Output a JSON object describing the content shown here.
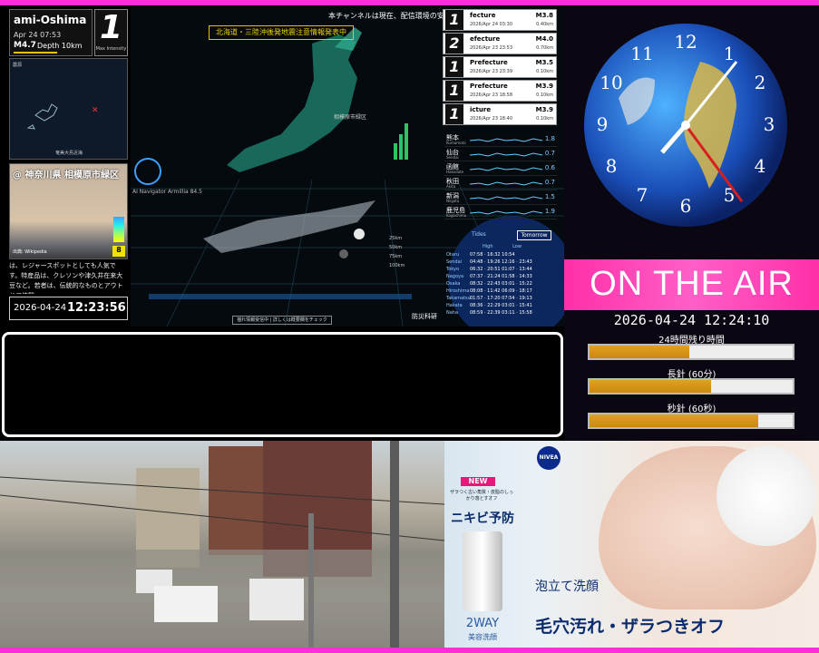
{
  "quake": {
    "location": "ami-Oshima",
    "time": "Apr 24 07:53",
    "magnitude": "M4.7",
    "depth": "Depth 10km",
    "max_intensity": "1",
    "max_intensity_label": "Max Intensity",
    "minimap_label": "震源",
    "minimap_caption": "奄美大島近海"
  },
  "photo": {
    "title": "@ 神奈川県 相模原市緑区",
    "credit": "出典: Wikipedia",
    "level": "8"
  },
  "description": "は、レジャースポットとしても人気です。特産品は、クレソンや津久井在来大豆など。若者は、伝統的なものとアウトドア体験…",
  "local_clock": {
    "date": "2026-04-24",
    "time": "12:23:56"
  },
  "map": {
    "ticker": "本チャンネルは現在、配信環境の安定",
    "alert": "北海道・三陸沖後発地震注意情報発表中",
    "radar_label": "AI Navigator Armillia 84.5",
    "km_labels": [
      "25km",
      "50km",
      "75km",
      "100km"
    ],
    "footer": "揺れ情報受信中 | 詳しくは概要欄をチェック",
    "brand": "防災科研",
    "region_label": "相模原市緑区"
  },
  "quake_list": [
    {
      "n": "1",
      "place": "fecture",
      "sub": "2026/Apr 24 03:30",
      "mag": "M3.8",
      "depth": "0.40km"
    },
    {
      "n": "2",
      "place": "efecture",
      "sub": "2026/Apr 23 23:53",
      "mag": "M4.0",
      "depth": "0.70km"
    },
    {
      "n": "1",
      "place": "Prefecture",
      "sub": "2026/Apr 23 23:39",
      "mag": "M3.5",
      "depth": "0.10km"
    },
    {
      "n": "1",
      "place": "Prefecture",
      "sub": "2026/Apr 23 18:58",
      "mag": "M3.9",
      "depth": "0.10km"
    },
    {
      "n": "1",
      "place": "icture",
      "sub": "2026/Apr 23 18:40",
      "mag": "M3.9",
      "depth": "0.10km"
    }
  ],
  "stations": [
    {
      "jp": "熊本",
      "en": "Kumamoto",
      "val": "1.8"
    },
    {
      "jp": "仙台",
      "en": "Sendai",
      "val": "0.7"
    },
    {
      "jp": "函館",
      "en": "Hakodate",
      "val": "0.6"
    },
    {
      "jp": "秋田",
      "en": "Akita",
      "val": "0.7"
    },
    {
      "jp": "新潟",
      "en": "Niigata",
      "val": "1.5"
    },
    {
      "jp": "鹿児島",
      "en": "Kagoshima",
      "val": "1.9"
    }
  ],
  "tide": {
    "label": "Tides",
    "tomorrow": "Tomorrow",
    "header": "High Low",
    "rows": [
      {
        "c": "Otaru",
        "v": "07:58 · 16:32 10:54"
      },
      {
        "c": "Sendai",
        "v": "04:48 · 19:26 12:16 · 23:43"
      },
      {
        "c": "Tokyo",
        "v": "06:32 · 20:51 01:07 · 13:44"
      },
      {
        "c": "Nagoya",
        "v": "07:37 · 21:24 01:58 · 14:33"
      },
      {
        "c": "Osaka",
        "v": "08:32 · 22:43 03:01 · 15:22"
      },
      {
        "c": "Hiroshima",
        "v": "08:08 · 11:42 06:09 · 18:17"
      },
      {
        "c": "Takamatsu",
        "v": "01:57 · 17:20 07:54 · 19:13"
      },
      {
        "c": "Hakata",
        "v": "08:36 · 22:29 03:01 · 15:41"
      },
      {
        "c": "Naha",
        "v": "08:59 · 22:39 03:11 · 15:58"
      }
    ]
  },
  "clock_panel": {
    "on_air": "ON THE AIR",
    "datetime": "2026-04-24 12:24:10",
    "bars": [
      {
        "label": "24時間残り時間",
        "fraction": 0.49
      },
      {
        "label": "長針 (60分)",
        "fraction": 0.6
      },
      {
        "label": "秒針 (60秒)",
        "fraction": 0.83
      }
    ]
  },
  "ad": {
    "logo": "NIVEA",
    "new": "NEW",
    "small": "ザラつく古い角質・皮脂のしっかり落とすオフ",
    "nikibi": "ニキビ予防",
    "way": "2WAY",
    "way2": "美容洗顔",
    "awa": "泡立て洗顔",
    "head": "毛穴汚れ・ザラつきオフ"
  }
}
